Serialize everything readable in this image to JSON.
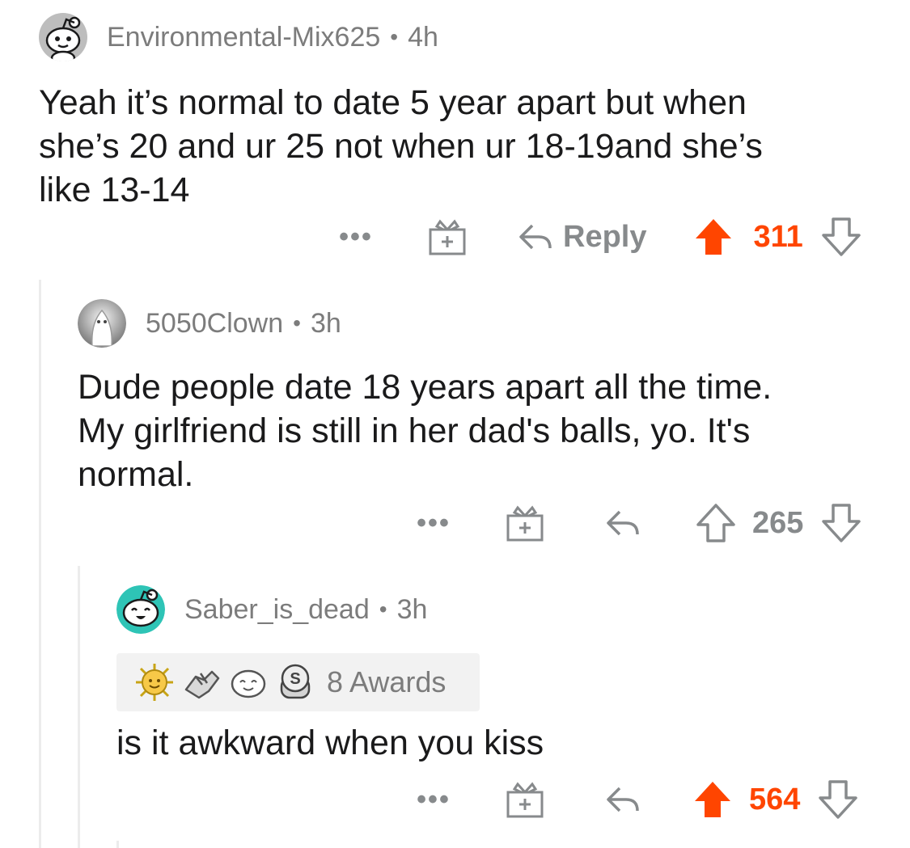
{
  "comments": [
    {
      "username": "Environmental-Mix625",
      "age": "4h",
      "body": "Yeah it’s normal to date 5 year apart but when\nshe’s 20 and ur 25 not when ur 18-19and she’s\nlike 13-14",
      "more_label": "•••",
      "reply_label": "Reply",
      "score": "311",
      "voted": "up",
      "avatar_icon": "snoo-avatar-icon"
    },
    {
      "username": "5050Clown",
      "age": "3h",
      "body": "Dude people date 18 years apart all the time.\nMy girlfriend is still in her dad's balls, yo.  It's\nnormal.",
      "more_label": "•••",
      "score": "265",
      "voted": "none",
      "avatar_icon": "ghost-avatar-icon"
    },
    {
      "username": "Saber_is_dead",
      "age": "3h",
      "awards_label": "8 Awards",
      "award_icons": [
        "sun-award-icon",
        "handshake-award-icon",
        "wholesome-face-award-icon",
        "silver-coin-award-icon"
      ],
      "body": "is it awkward when you kiss",
      "more_label": "•••",
      "score": "564",
      "voted": "up",
      "avatar_icon": "snoo-avatar-icon"
    }
  ],
  "separator": "•",
  "colors": {
    "upvote": "#ff4500",
    "meta_text": "#7c7c7c",
    "action_icon": "#878a8c",
    "thread_line": "#ececec",
    "awards_bg": "#f2f2f2"
  }
}
